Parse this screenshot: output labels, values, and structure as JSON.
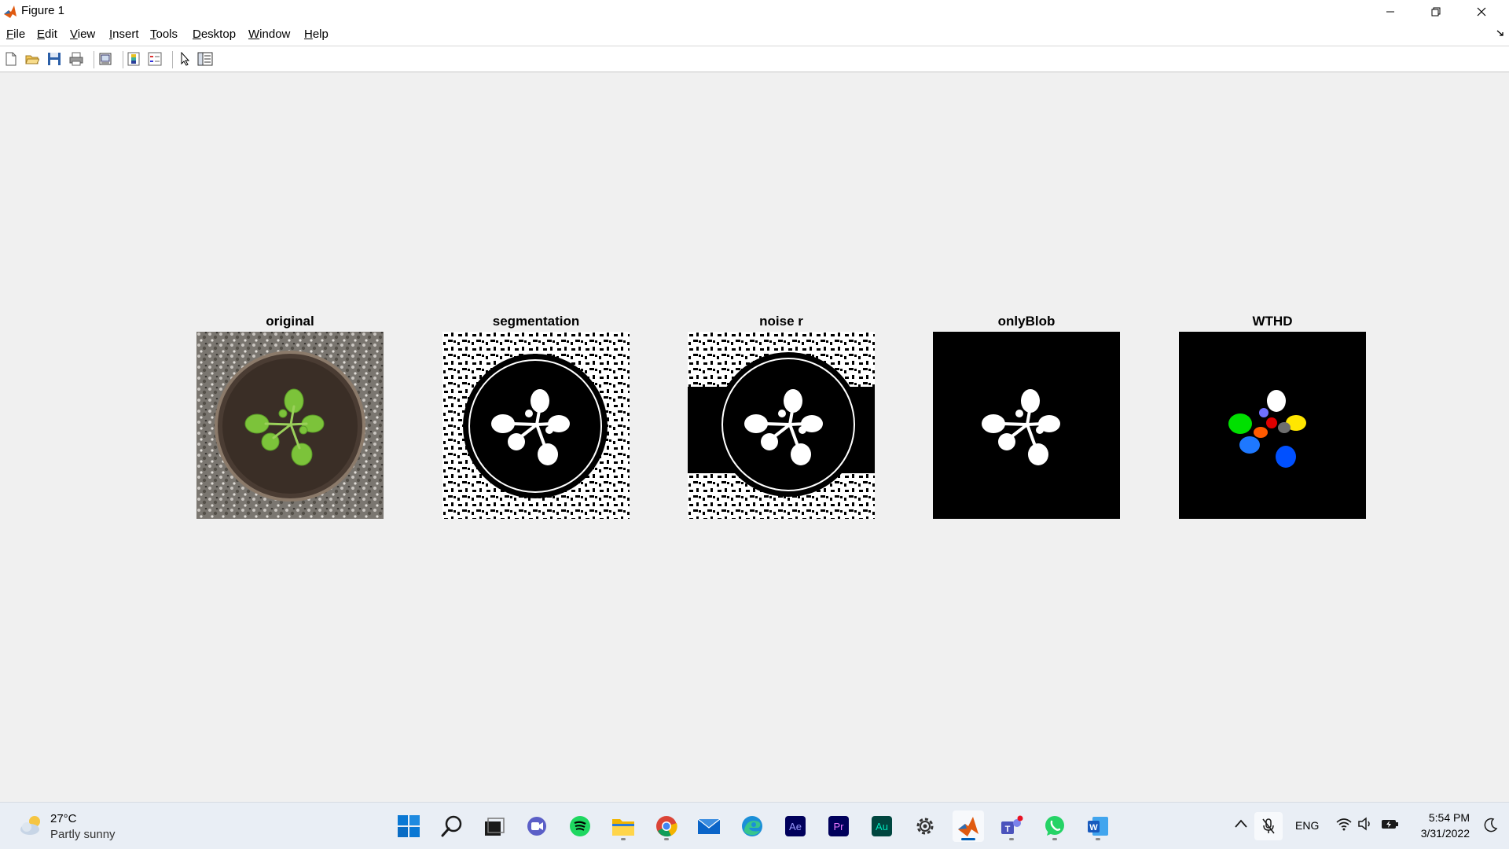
{
  "window": {
    "title": "Figure 1"
  },
  "menu": [
    {
      "acc": "F",
      "rest": "ile"
    },
    {
      "acc": "E",
      "rest": "dit"
    },
    {
      "acc": "V",
      "rest": "iew"
    },
    {
      "acc": "I",
      "rest": "nsert"
    },
    {
      "acc": "T",
      "rest": "ools"
    },
    {
      "acc": "D",
      "rest": "esktop"
    },
    {
      "acc": "W",
      "rest": "indow"
    },
    {
      "acc": "H",
      "rest": "elp"
    }
  ],
  "toolbar": [
    "new-figure-icon",
    "open-file-icon",
    "save-icon",
    "print-icon",
    "link-plot-icon",
    "colorbar-icon",
    "legend-icon",
    "pointer-icon",
    "property-inspector-icon"
  ],
  "figure": {
    "subplots": [
      {
        "title": "original"
      },
      {
        "title": "segmentation"
      },
      {
        "title": "noise r"
      },
      {
        "title": "onlyBlob"
      },
      {
        "title": "WTHD"
      }
    ]
  },
  "taskbar": {
    "weather": {
      "temp": "27°C",
      "desc": "Partly sunny"
    },
    "apps": [
      "start",
      "search",
      "task-view",
      "chat",
      "spotify",
      "file-explorer",
      "chrome",
      "mail",
      "edge",
      "after-effects",
      "premiere",
      "audition",
      "settings",
      "matlab",
      "teams",
      "whatsapp",
      "word"
    ],
    "lang": "ENG",
    "time": "5:54 PM",
    "date": "3/31/2022"
  },
  "colors": {
    "accent": "#005fb8",
    "wthd_segments": [
      "#00e000",
      "#ff5a00",
      "#1e78ff",
      "#0050ff",
      "#ffe600",
      "#6e6e6e",
      "#7070ff",
      "#e00000"
    ]
  }
}
